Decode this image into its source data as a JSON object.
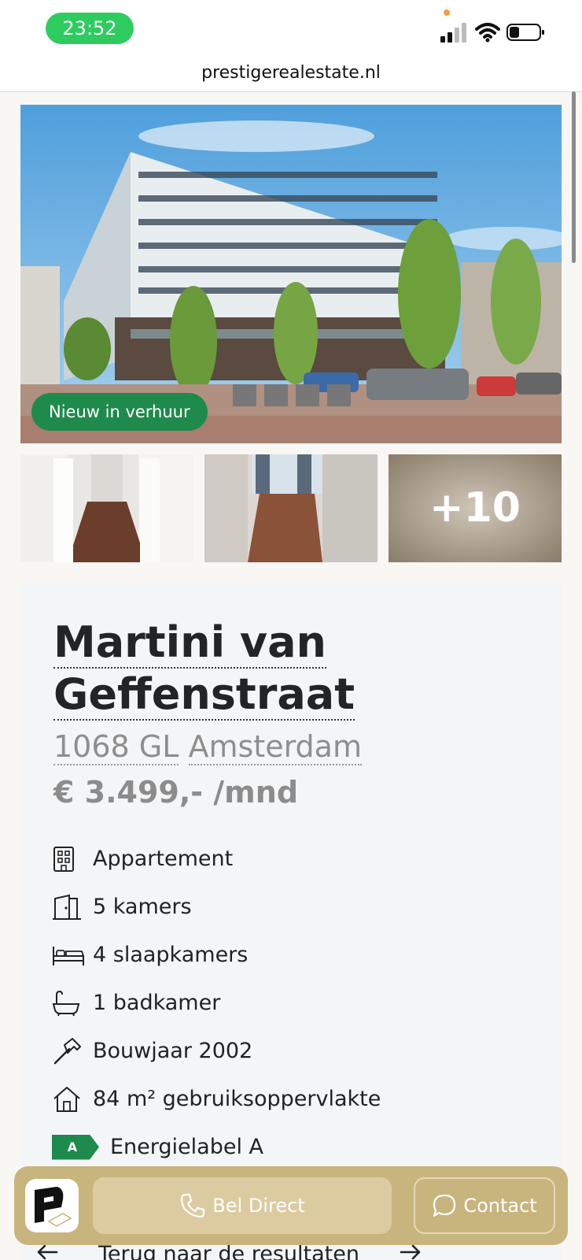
{
  "status": {
    "time": "23:52"
  },
  "browser": {
    "url": "prestigerealestate.nl"
  },
  "gallery": {
    "badge": "Nieuw in verhuur",
    "more": "+10"
  },
  "listing": {
    "title_line1": "Martini van",
    "title_line2": "Geffenstraat",
    "postcode": "1068 GL",
    "city": "Amsterdam",
    "price": "€ 3.499,- /mnd"
  },
  "features": [
    {
      "icon": "building-icon",
      "text": "Appartement"
    },
    {
      "icon": "door-icon",
      "text": "5 kamers"
    },
    {
      "icon": "bed-icon",
      "text": "4 slaapkamers"
    },
    {
      "icon": "bathtub-icon",
      "text": "1 badkamer"
    },
    {
      "icon": "hammer-icon",
      "text": "Bouwjaar 2002"
    },
    {
      "icon": "house-icon",
      "text": "84 m² gebruiksoppervlakte"
    },
    {
      "icon": "energy-label-icon",
      "label": "A",
      "text": "Energielabel A"
    }
  ],
  "actions": {
    "call": "Bel Direct",
    "contact": "Contact"
  },
  "nav": {
    "back": "Terug naar de resultaten"
  },
  "colors": {
    "accent_green": "#1e8a4c",
    "gold": "#c8b47d",
    "status_green": "#2ecc5f"
  }
}
